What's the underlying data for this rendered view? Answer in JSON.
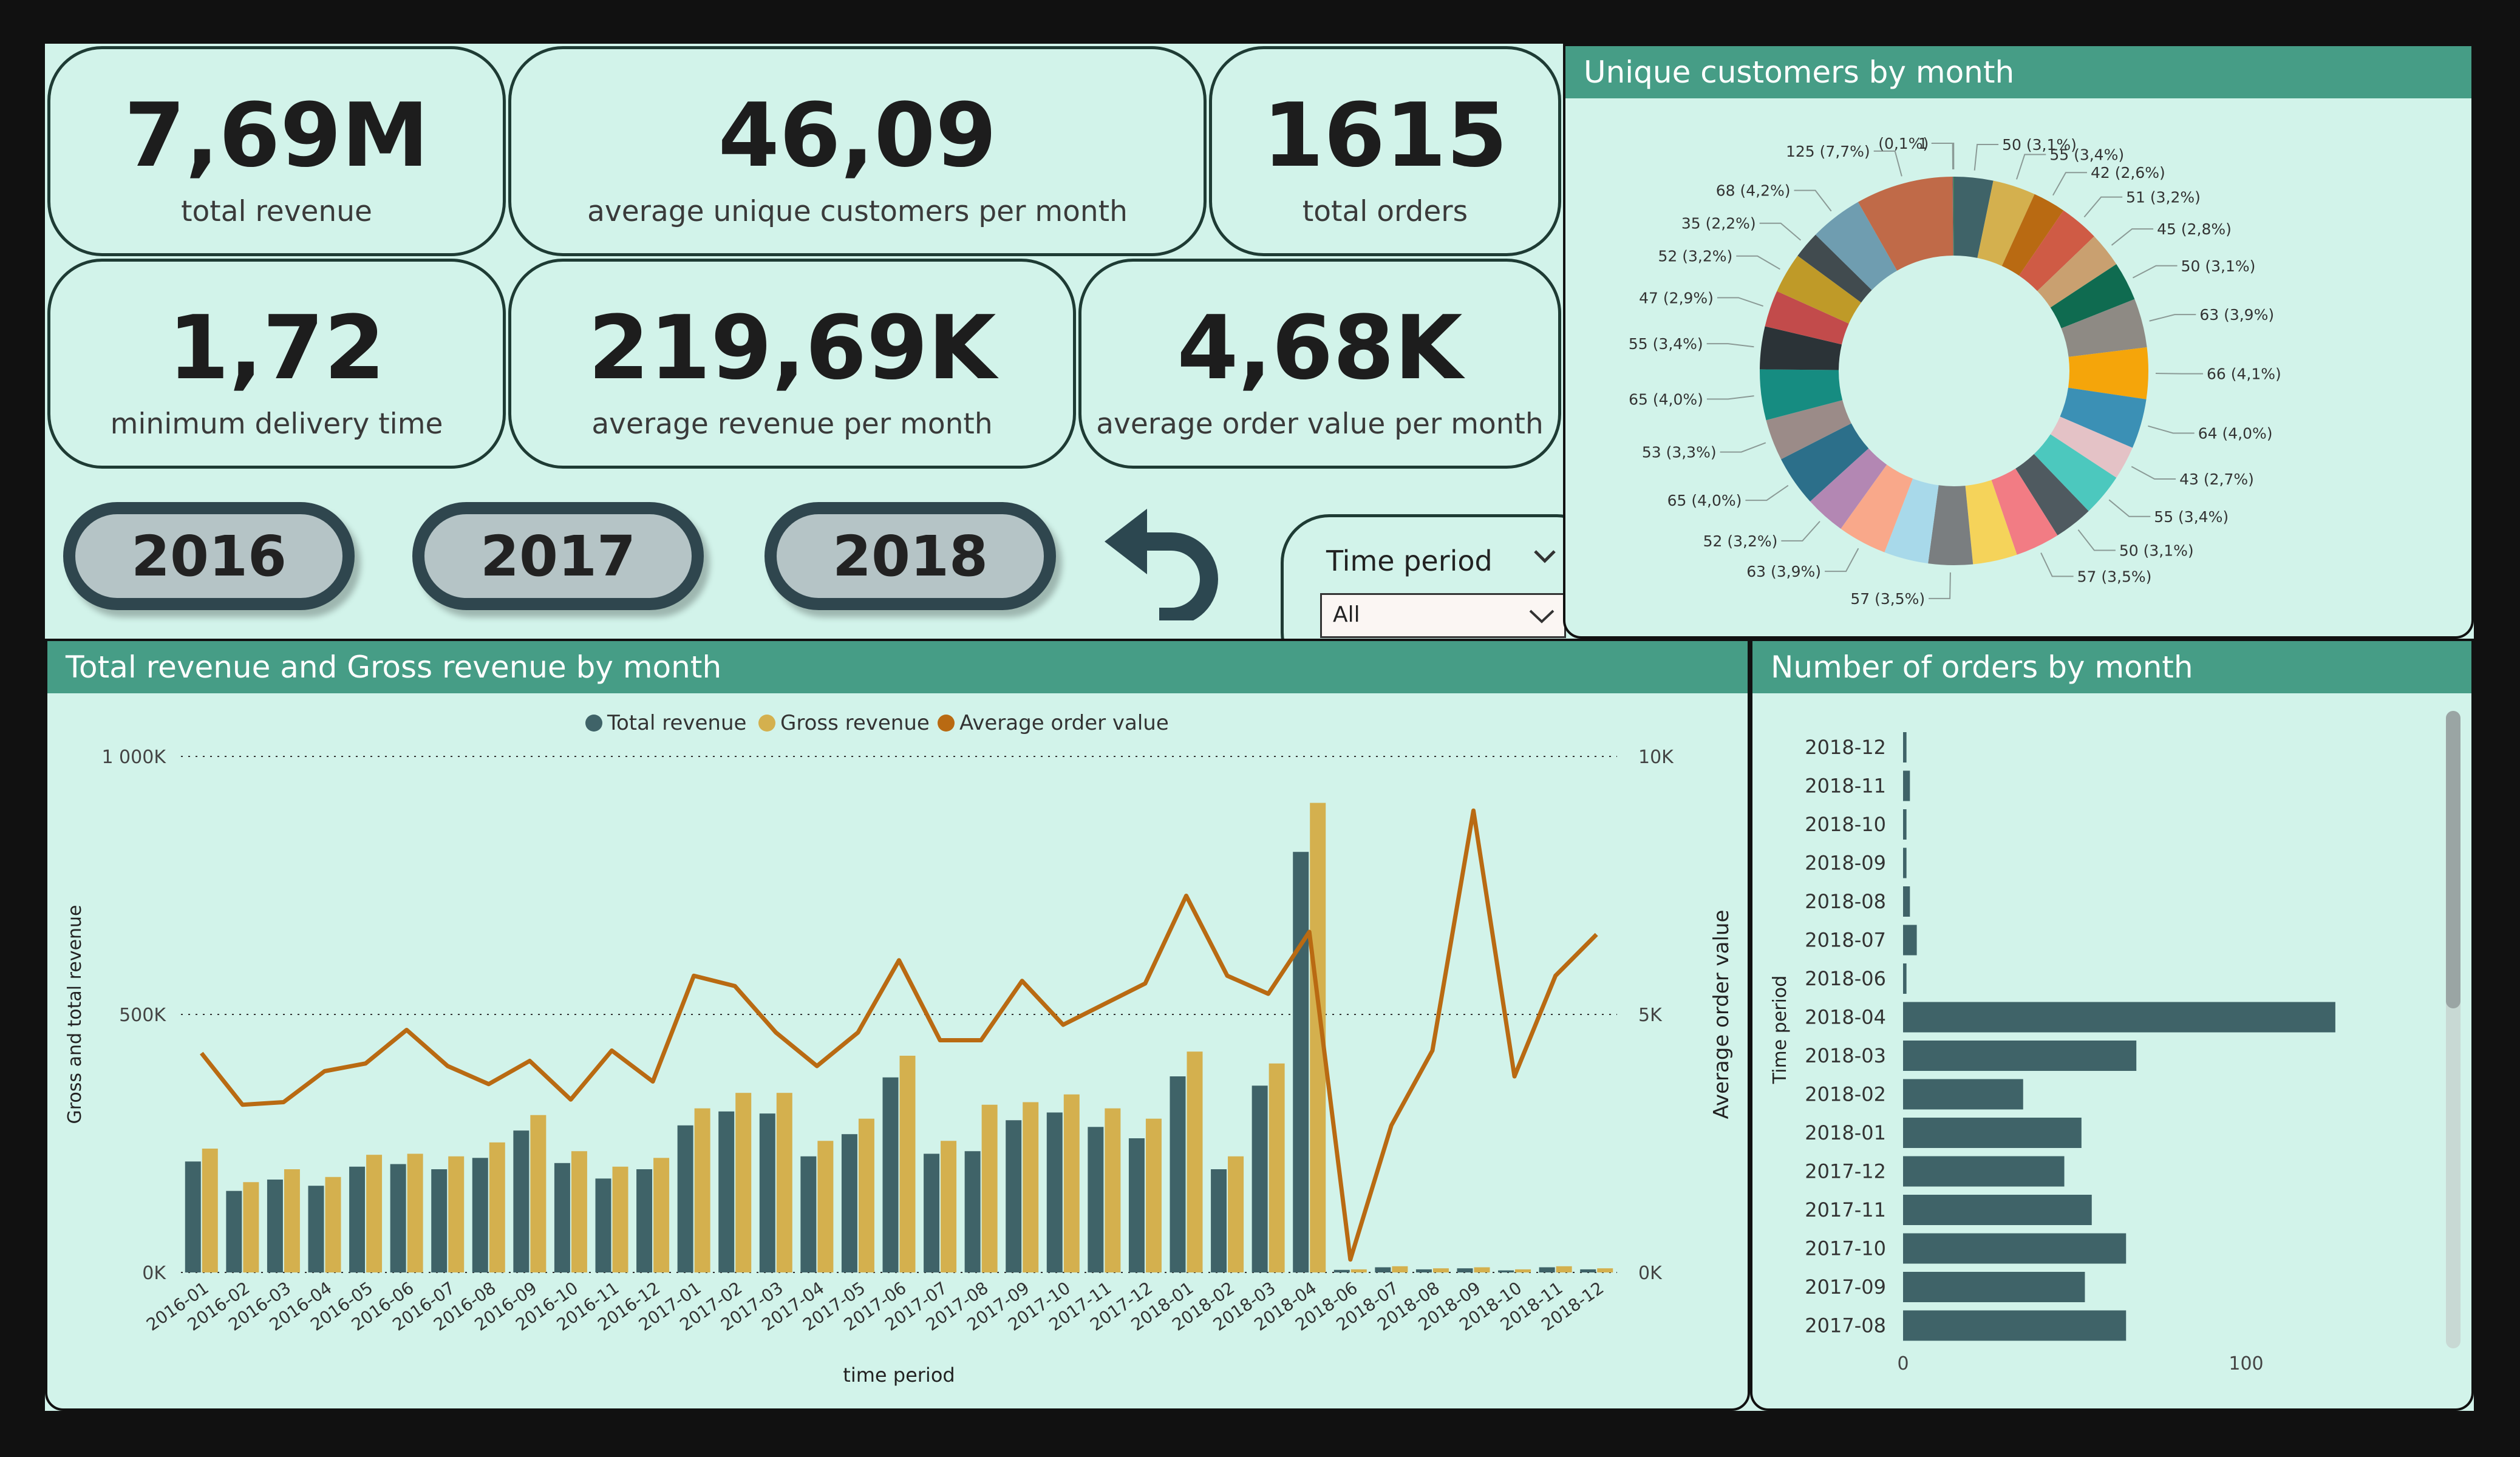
{
  "kpis": {
    "total_revenue": {
      "value": "7,69M",
      "label": "total revenue"
    },
    "avg_unique_customers": {
      "value": "46,09",
      "label": "average unique customers per month"
    },
    "total_orders": {
      "value": "1615",
      "label": "total orders"
    },
    "min_delivery": {
      "value": "1,72",
      "label": "minimum delivery time"
    },
    "avg_revenue": {
      "value": "219,69K",
      "label": "average revenue per month"
    },
    "avg_order_value": {
      "value": "4,68K",
      "label": "average order value per month"
    }
  },
  "year_buttons": [
    "2016",
    "2017",
    "2018"
  ],
  "reset_icon": "undo-arrow-icon",
  "slicer": {
    "title": "Time period",
    "selected": "All",
    "icon": "chevron-down-icon"
  },
  "colors": {
    "panel_header": "#469d86",
    "background": "#d2f3ea",
    "total_revenue": "#3f6368",
    "gross_revenue": "#d4b04e",
    "avg_order_value": "#b96a12"
  },
  "chart_data": [
    {
      "type": "pie",
      "title": "Unique customers by month",
      "donut": true,
      "slices": [
        {
          "label": "50 (3,1%)",
          "value": 50,
          "color": "#3f6368"
        },
        {
          "label": "55 (3,4%)",
          "value": 55,
          "color": "#d4b04e"
        },
        {
          "label": "42 (2,6%)",
          "value": 42,
          "color": "#b96a12"
        },
        {
          "label": "51 (3,2%)",
          "value": 51,
          "color": "#cf5b45"
        },
        {
          "label": "45 (2,8%)",
          "value": 45,
          "color": "#c9a070"
        },
        {
          "label": "50 (3,1%)",
          "value": 50,
          "color": "#0f6b50"
        },
        {
          "label": "63 (3,9%)",
          "value": 63,
          "color": "#8e8a84"
        },
        {
          "label": "66 (4,1%)",
          "value": 66,
          "color": "#f5a50a"
        },
        {
          "label": "64 (4,0%)",
          "value": 64,
          "color": "#3b90b5"
        },
        {
          "label": "43 (2,7%)",
          "value": 43,
          "color": "#e4c2c6"
        },
        {
          "label": "55 (3,4%)",
          "value": 55,
          "color": "#4cc8be"
        },
        {
          "label": "50 (3,1%)",
          "value": 50,
          "color": "#4f5a60"
        },
        {
          "label": "57 (3,5%)",
          "value": 57,
          "color": "#f27c84"
        },
        {
          "label": "",
          "value": 57,
          "color": "#f5d35a"
        },
        {
          "label": "57 (3,5%)",
          "value": 57,
          "color": "#7a7e80"
        },
        {
          "label": "",
          "value": 57,
          "color": "#a8d9ea"
        },
        {
          "label": "63 (3,9%)",
          "value": 63,
          "color": "#f9a88a"
        },
        {
          "label": "52 (3,2%)",
          "value": 52,
          "color": "#b387b3"
        },
        {
          "label": "65 (4,0%)",
          "value": 65,
          "color": "#2c6f8a"
        },
        {
          "label": "53 (3,3%)",
          "value": 53,
          "color": "#9b8b88"
        },
        {
          "label": "65 (4,0%)",
          "value": 65,
          "color": "#168c81"
        },
        {
          "label": "55 (3,4%)",
          "value": 55,
          "color": "#2b3337"
        },
        {
          "label": "47 (2,9%)",
          "value": 47,
          "color": "#c24b4b"
        },
        {
          "label": "52 (3,2%)",
          "value": 52,
          "color": "#bf9a28"
        },
        {
          "label": "35 (2,2%)",
          "value": 35,
          "color": "#414b4f"
        },
        {
          "label": "68 (4,2%)",
          "value": 68,
          "color": "#6f9db0"
        },
        {
          "label": "125 (7,7%)",
          "value": 125,
          "color": "#c06a48"
        },
        {
          "label": "1",
          "value": 1,
          "color": "#7b4e6c"
        },
        {
          "label": "(0,1%)",
          "value": 1,
          "color": "#2d8a50"
        }
      ]
    },
    {
      "type": "bar",
      "title": "Total revenue and Gross revenue by month",
      "xlabel": "time period",
      "ylabel": "Gross and total revenue",
      "y2label": "Average order value",
      "ylim": [
        0,
        1000000
      ],
      "y2lim": [
        0,
        10000
      ],
      "yticks": [
        "0K",
        "500K",
        "1 000K"
      ],
      "y2ticks": [
        "0K",
        "5K",
        "10K"
      ],
      "grid": true,
      "legend_position": "top-center",
      "legend": [
        "Total revenue",
        "Gross revenue",
        "Average order value"
      ],
      "categories": [
        "2016-01",
        "2016-02",
        "2016-03",
        "2016-04",
        "2016-05",
        "2016-06",
        "2016-07",
        "2016-08",
        "2016-09",
        "2016-10",
        "2016-11",
        "2016-12",
        "2017-01",
        "2017-02",
        "2017-03",
        "2017-04",
        "2017-05",
        "2017-06",
        "2017-07",
        "2017-08",
        "2017-09",
        "2017-10",
        "2017-11",
        "2017-12",
        "2018-01",
        "2018-02",
        "2018-03",
        "2018-04",
        "2018-06",
        "2018-07",
        "2018-08",
        "2018-09",
        "2018-10",
        "2018-11",
        "2018-12"
      ],
      "series": [
        {
          "name": "Total revenue",
          "type": "bar",
          "axis": "left",
          "color": "#3f6368",
          "values": [
            215000,
            158000,
            180000,
            168000,
            205000,
            210000,
            200000,
            222000,
            275000,
            212000,
            182000,
            200000,
            285000,
            312000,
            308000,
            225000,
            268000,
            378000,
            230000,
            235000,
            295000,
            310000,
            282000,
            260000,
            380000,
            200000,
            362000,
            815000,
            5000,
            10000,
            6000,
            8000,
            4000,
            10000,
            6000
          ]
        },
        {
          "name": "Gross revenue",
          "type": "bar",
          "axis": "left",
          "color": "#d4b04e",
          "values": [
            240000,
            175000,
            200000,
            185000,
            228000,
            230000,
            225000,
            252000,
            305000,
            235000,
            205000,
            222000,
            318000,
            348000,
            348000,
            255000,
            298000,
            420000,
            255000,
            325000,
            330000,
            345000,
            318000,
            298000,
            428000,
            225000,
            405000,
            910000,
            6000,
            12000,
            8000,
            10000,
            6000,
            12000,
            8000
          ]
        },
        {
          "name": "Average order value",
          "type": "line",
          "axis": "right",
          "color": "#b96a12",
          "values": [
            4250,
            3250,
            3300,
            3900,
            4050,
            4700,
            4000,
            3650,
            4100,
            3350,
            4300,
            3700,
            5750,
            5550,
            4650,
            4000,
            4650,
            6050,
            4500,
            4500,
            5650,
            4800,
            5200,
            5600,
            7300,
            5750,
            5400,
            6600,
            250,
            2850,
            4300,
            8950,
            3800,
            5750,
            6550
          ]
        }
      ]
    },
    {
      "type": "bar",
      "orientation": "horizontal",
      "title": "Number of orders by month",
      "ylabel": "Time period",
      "xticks": [
        "0",
        "100"
      ],
      "xlim": [
        0,
        178
      ],
      "categories": [
        "2018-12",
        "2018-11",
        "2018-10",
        "2018-09",
        "2018-08",
        "2018-07",
        "2018-06",
        "2018-04",
        "2018-03",
        "2018-02",
        "2018-01",
        "2017-12",
        "2017-11",
        "2017-10",
        "2017-09",
        "2017-08"
      ],
      "values": [
        1,
        2,
        1,
        1,
        2,
        4,
        1,
        126,
        68,
        35,
        52,
        47,
        55,
        65,
        53,
        65
      ],
      "color": "#3f6368"
    }
  ]
}
